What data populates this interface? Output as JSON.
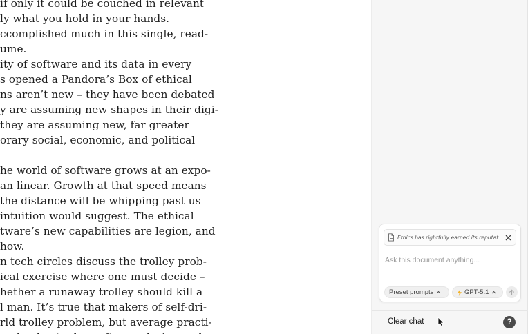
{
  "document": {
    "lines": [
      "if only it could be couched in relevant",
      "ly what you hold in your hands.",
      "ccomplished much in this single, read-",
      "ume.",
      "ity of software and its data in every",
      "s opened a Pandora’s Box of ethical",
      "ns aren’t new – they have been debated",
      "y are assuming new shapes in their digi-",
      " they are assuming new, far greater",
      "orary social, economic, and political",
      "",
      "he world of software grows at an expo-",
      "an linear. Growth at that speed means",
      " the distance will be whipping past us",
      "intuition would suggest. The ethical",
      "tware’s new capabilities are legion, and",
      "how.",
      "n tech circles discuss the trolley prob-",
      "ical exercise where one must decide –",
      "hether a runaway trolley should kill a",
      "l man. It’s true that makers of self-dri-",
      "rld trolley problem, but average practi-",
      "mple, day-to-day software design and"
    ]
  },
  "chat": {
    "context_snippet": "Ethics has rightfully earned its reputation...",
    "input_placeholder": "Ask this document anything...",
    "preset_prompts_label": "Preset prompts",
    "model_label": "GPT-5.1",
    "clear_chat_label": "Clear chat",
    "help_label": "?"
  },
  "icons": {
    "document": "document-icon",
    "close": "close-icon",
    "chevron": "chevron-up-icon",
    "bolt": "bolt-icon",
    "send": "arrow-up-icon",
    "cursor": "mouse-pointer-icon"
  },
  "colors": {
    "panel_background": "#f6f6f6",
    "help_button": "#4a4a4a",
    "bolt": "#f2b32a"
  }
}
